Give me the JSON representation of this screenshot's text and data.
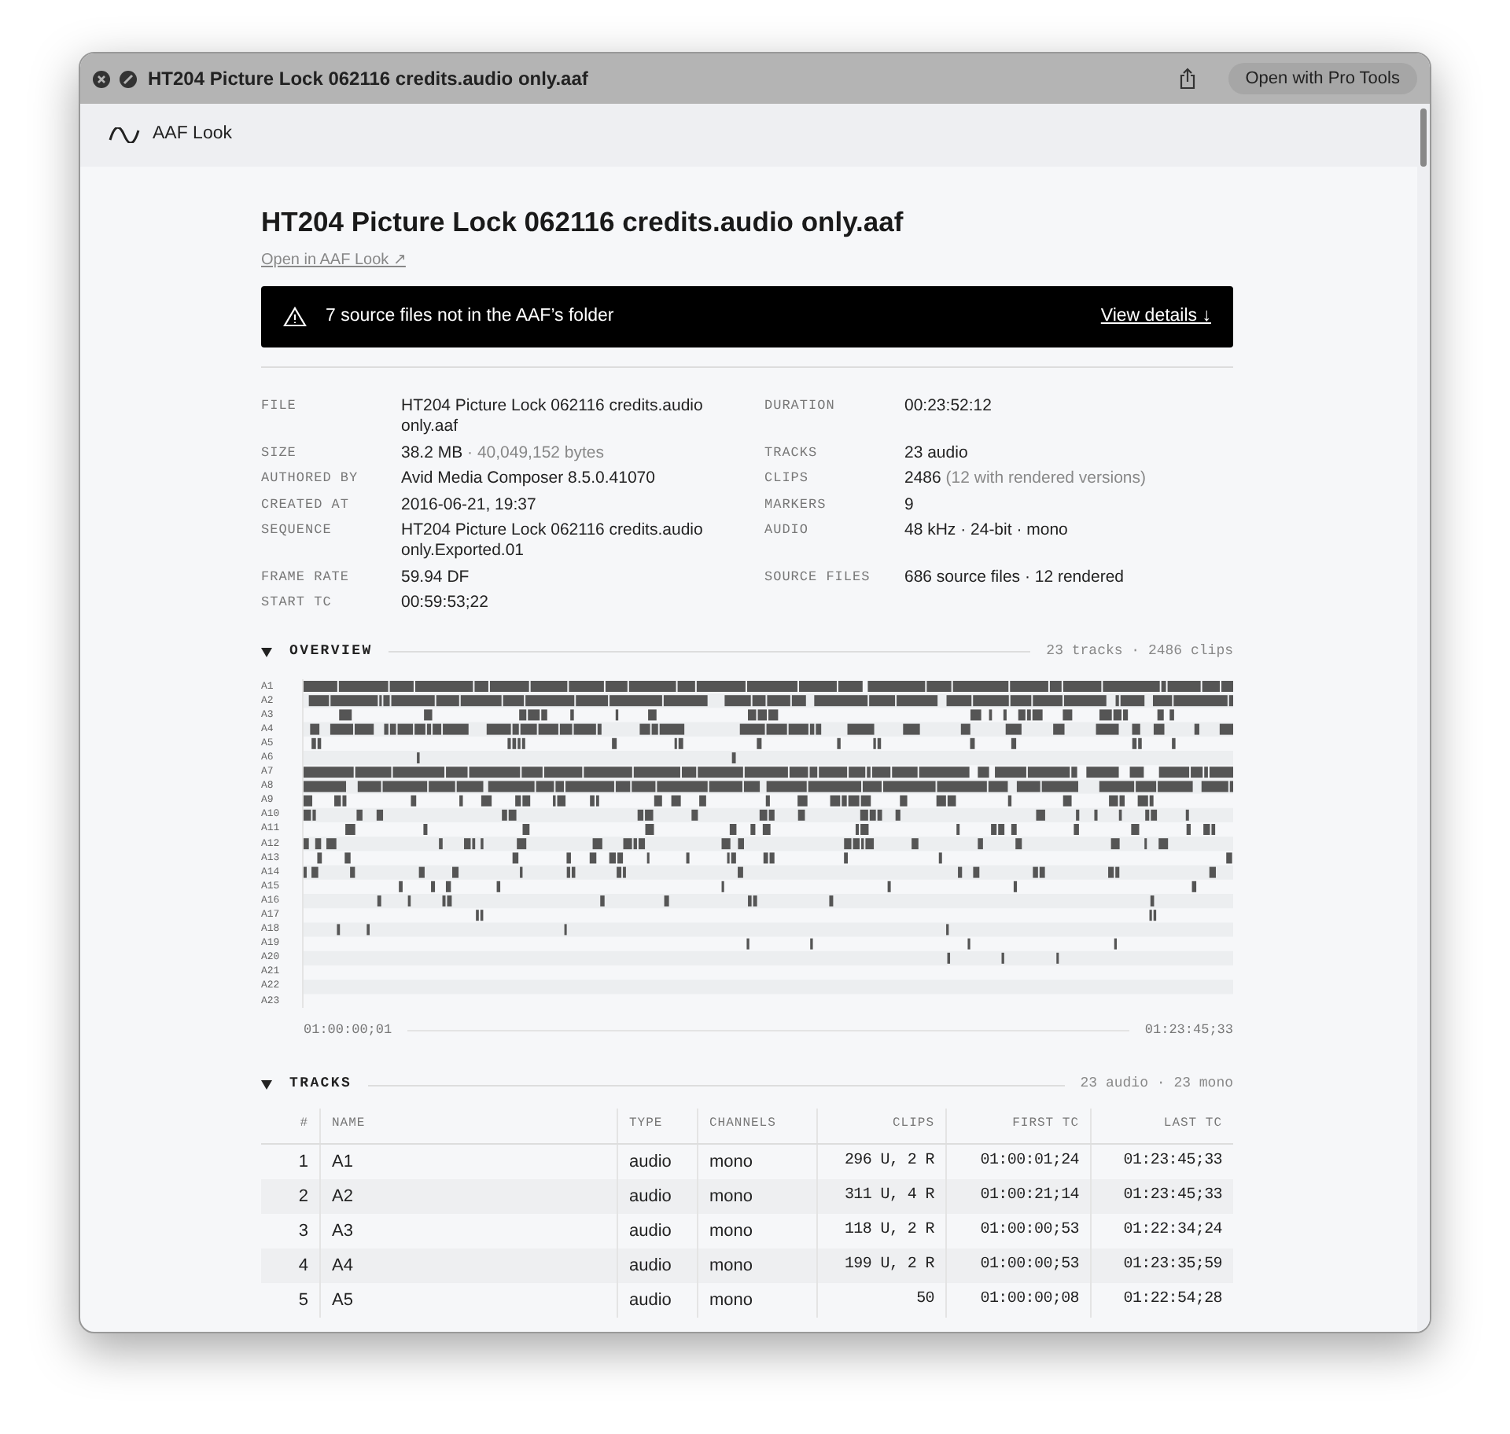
{
  "window": {
    "title": "HT204 Picture Lock 062116 credits.audio only.aaf",
    "open_button": "Open with Pro Tools"
  },
  "toolbar": {
    "app_name": "AAF Look"
  },
  "heading": "HT204 Picture Lock 062116 credits.audio only.aaf",
  "open_link": "Open in AAF Look ↗",
  "banner": {
    "message": "7 source files not in the AAF’s folder",
    "action": "View details ↓"
  },
  "info_left": [
    {
      "label": "FILE",
      "value": "HT204 Picture Lock 062116 credits.audio only.aaf"
    },
    {
      "label": "SIZE",
      "value": "38.2 MB",
      "note": "· 40,049,152 bytes"
    },
    {
      "label": "AUTHORED BY",
      "value": "Avid Media Composer 8.5.0.41070"
    },
    {
      "label": "CREATED AT",
      "value": "2016-06-21, 19:37"
    },
    {
      "label": "SEQUENCE",
      "value": "HT204 Picture Lock 062116 credits.audio only.Exported.01"
    },
    {
      "label": "FRAME RATE",
      "value": "59.94 DF"
    },
    {
      "label": "START TC",
      "value": "00:59:53;22"
    }
  ],
  "info_right": [
    {
      "label": "DURATION",
      "value": "00:23:52:12"
    },
    {
      "label": "TRACKS",
      "value": "23 audio"
    },
    {
      "label": "CLIPS",
      "value": "2486",
      "note": "(12 with rendered versions)"
    },
    {
      "label": "MARKERS",
      "value": "9"
    },
    {
      "label": "AUDIO",
      "value": "48 kHz · 24-bit · mono"
    },
    {
      "label": "SOURCE FILES",
      "value": "686 source files · 12 rendered"
    }
  ],
  "overview": {
    "title": "OVERVIEW",
    "expanded": true,
    "summary": "23 tracks · 2486 clips",
    "track_labels": [
      "A1",
      "A2",
      "A3",
      "A4",
      "A5",
      "A6",
      "A7",
      "A8",
      "A9",
      "A10",
      "A11",
      "A12",
      "A13",
      "A14",
      "A15",
      "A16",
      "A17",
      "A18",
      "A19",
      "A20",
      "A21",
      "A22",
      "A23"
    ],
    "start_tc": "01:00:00;01",
    "end_tc": "01:23:45;33"
  },
  "tracks": {
    "title": "TRACKS",
    "expanded": true,
    "summary": "23 audio · 23 mono",
    "columns": [
      "#",
      "NAME",
      "TYPE",
      "CHANNELS",
      "CLIPS",
      "FIRST TC",
      "LAST TC"
    ],
    "rows": [
      [
        "1",
        "A1",
        "audio",
        "mono",
        "296 U, 2 R",
        "01:00:01;24",
        "01:23:45;33"
      ],
      [
        "2",
        "A2",
        "audio",
        "mono",
        "311 U, 4 R",
        "01:00:21;14",
        "01:23:45;33"
      ],
      [
        "3",
        "A3",
        "audio",
        "mono",
        "118 U, 2 R",
        "01:00:00;53",
        "01:22:34;24"
      ],
      [
        "4",
        "A4",
        "audio",
        "mono",
        "199 U, 2 R",
        "01:00:00;53",
        "01:23:35;59"
      ],
      [
        "5",
        "A5",
        "audio",
        "mono",
        "50",
        "01:00:00;08",
        "01:22:54;28"
      ]
    ]
  }
}
